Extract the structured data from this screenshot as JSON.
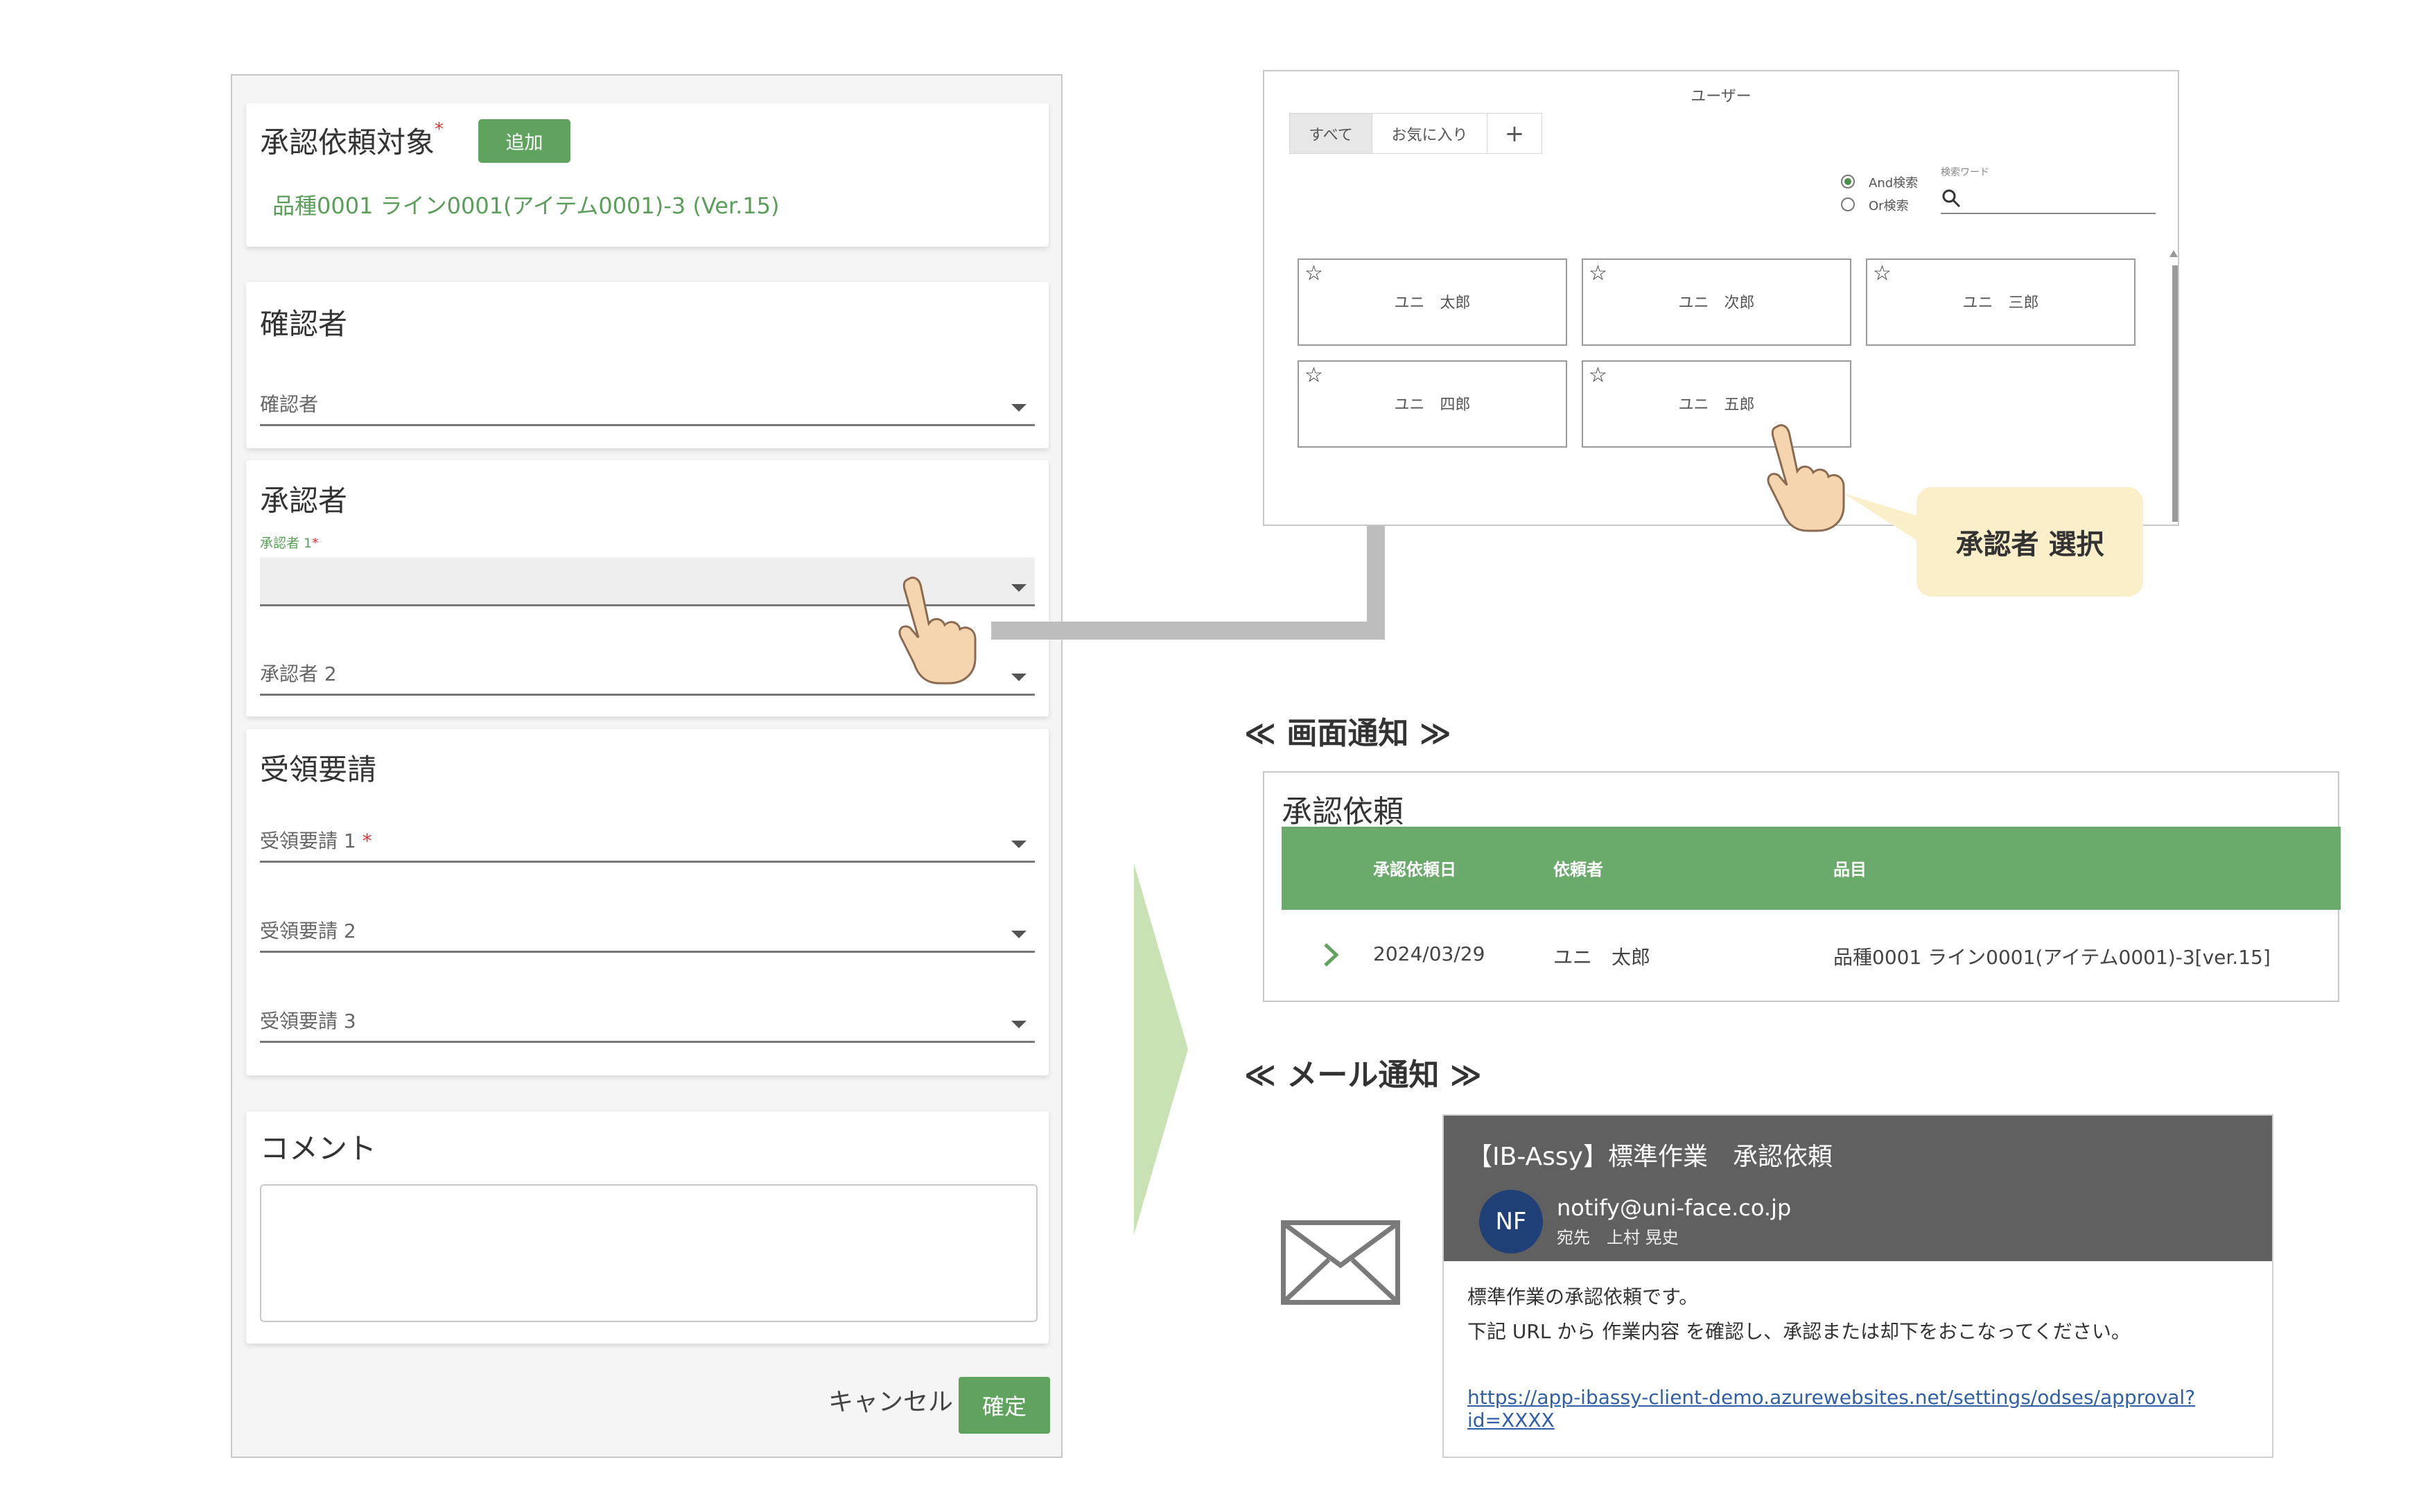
{
  "form": {
    "target": {
      "title": "承認依頼対象",
      "required_mark": "*",
      "add_label": "追加",
      "value": "品種0001 ライン0001(アイテム0001)-3 (Ver.15)"
    },
    "confirmer": {
      "title": "確認者",
      "field_label": "確認者"
    },
    "approver": {
      "title": "承認者",
      "field1_small_label": "承認者 1",
      "field1_req": "*",
      "field2_label": "承認者 2"
    },
    "receipt": {
      "title": "受領要請",
      "field1_label": "受領要請 1",
      "field1_req": "*",
      "field2_label": "受領要請 2",
      "field3_label": "受領要請 3"
    },
    "comment": {
      "title": "コメント",
      "value": ""
    },
    "cancel_label": "キャンセル",
    "ok_label": "確定"
  },
  "user_picker": {
    "title": "ユーザー",
    "tabs": [
      "すべて",
      "お気に入り",
      "+"
    ],
    "and_search": "And検索",
    "or_search": "Or検索",
    "search_word_label": "検索ワード",
    "search_value": "",
    "star_glyph": "☆",
    "users": [
      "ユニ　太郎",
      "ユニ　次郎",
      "ユニ　三郎",
      "ユニ　四郎",
      "ユニ　五郎"
    ]
  },
  "callout": "承認者 選択",
  "screen_notice": {
    "heading": "≪ 画面通知 ≫",
    "panel_title": "承認依頼",
    "columns": [
      "承認依頼日",
      "依頼者",
      "品目"
    ],
    "row": {
      "date": "2024/03/29",
      "requester": "ユニ　太郎",
      "item": "品種0001 ライン0001(アイテム0001)-3[ver.15]"
    }
  },
  "mail_notice": {
    "heading": "≪ メール通知 ≫",
    "subject": "【IB-Assy】標準作業　承認依頼",
    "avatar": "NF",
    "from": "notify@uni-face.co.jp",
    "to": "宛先　上村 晃史",
    "body_line1": "標準作業の承認依頼です。",
    "body_line2": "下記 URL から 作業内容 を確認し、承認または却下をおこなってください。",
    "link": "https://app-ibassy-client-demo.azurewebsites.net/settings/odses/approval?id=XXXX"
  },
  "colors": {
    "accent_green": "#5fa35f",
    "grid_green": "#6aaa6a",
    "flow_arrow": "#bdbdbd",
    "callout_bg": "#fbefc9",
    "mail_header": "#606060",
    "avatar_bg": "#1f3f77"
  }
}
